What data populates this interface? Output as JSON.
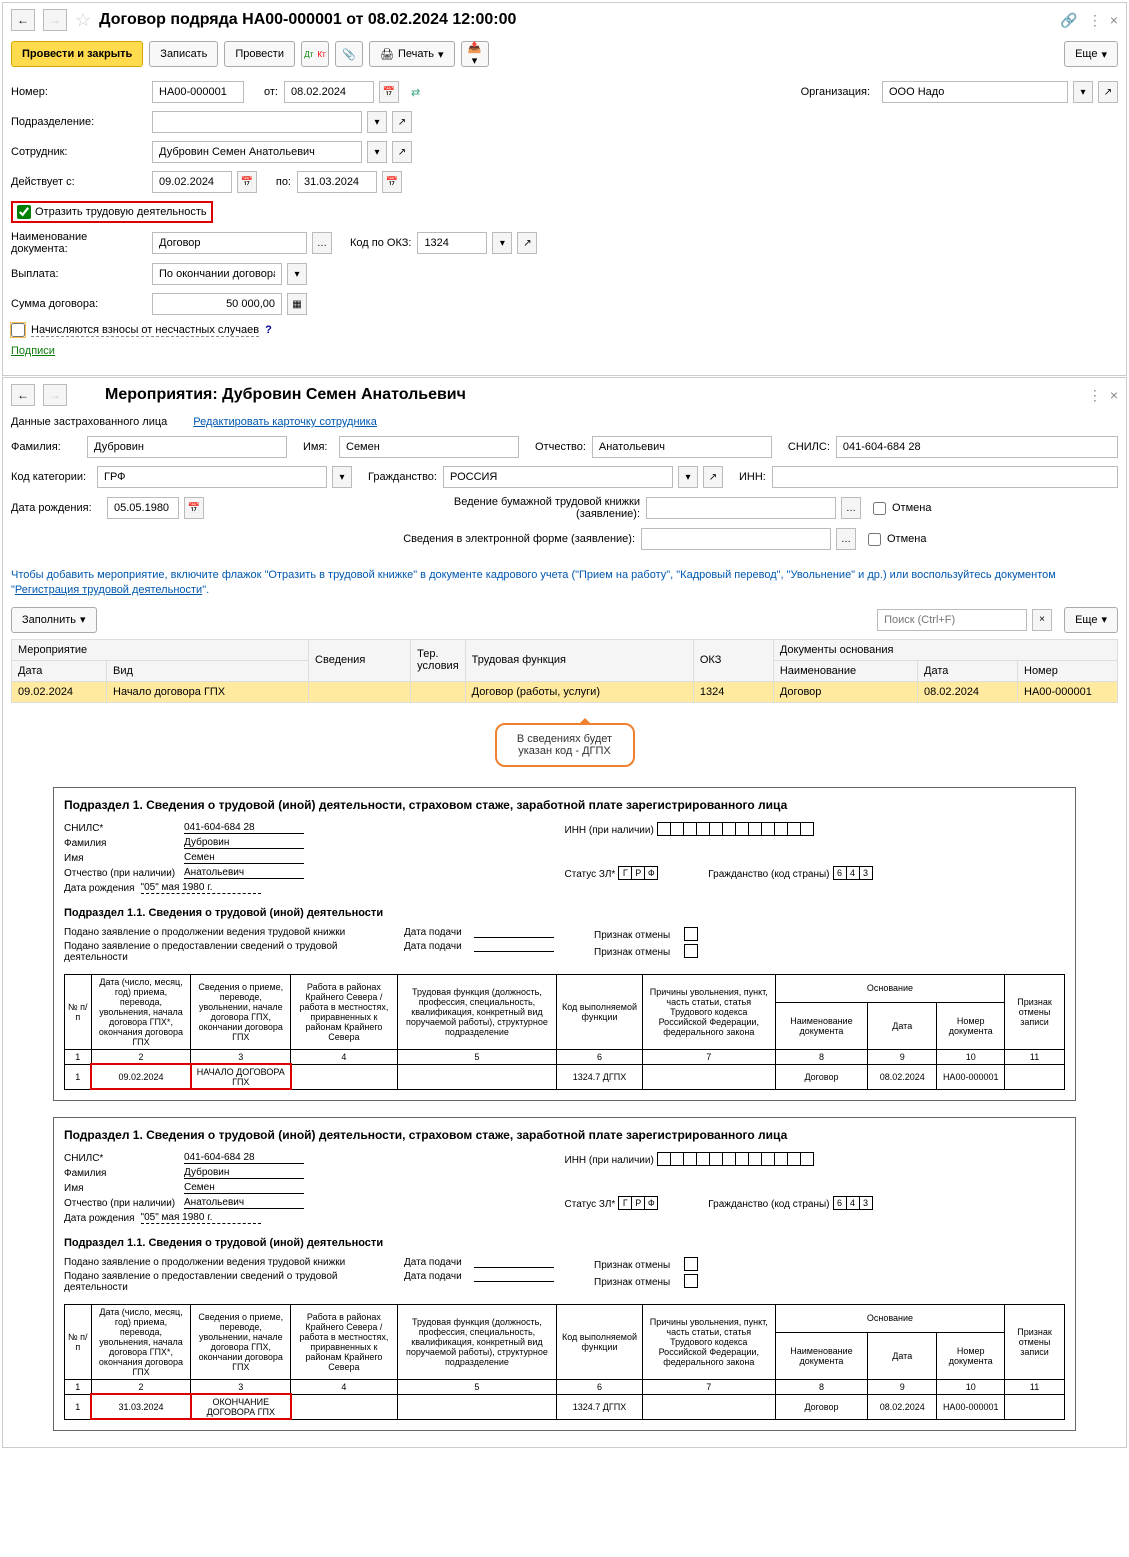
{
  "win1": {
    "title": "Договор подряда НА00-000001 от 08.02.2024 12:00:00",
    "toolbar": {
      "post_close": "Провести и закрыть",
      "write": "Записать",
      "post": "Провести",
      "print": "Печать",
      "more": "Еще"
    },
    "labels": {
      "number": "Номер:",
      "from": "от:",
      "org": "Организация:",
      "dept": "Подразделение:",
      "employee": "Сотрудник:",
      "valid_from": "Действует с:",
      "to": "по:",
      "reflect": "Отразить трудовую деятельность",
      "docname": "Наименование документа:",
      "okz": "Код по ОКЗ:",
      "payment": "Выплата:",
      "sum": "Сумма договора:",
      "accident": "Начисляются взносы от несчастных случаев",
      "signatures": "Подписи"
    },
    "values": {
      "number": "НА00-000001",
      "date": "08.02.2024",
      "org": "ООО Надо",
      "employee": "Дубровин Семен Анатольевич",
      "valid_from": "09.02.2024",
      "valid_to": "31.03.2024",
      "docname": "Договор",
      "okz": "1324",
      "payment": "По окончании договора",
      "sum": "50 000,00"
    }
  },
  "win2": {
    "title": "Мероприятия: Дубровин Семен Анатольевич",
    "insured_label": "Данные застрахованного лица",
    "edit_link": "Редактировать карточку сотрудника",
    "labels": {
      "lastname": "Фамилия:",
      "firstname": "Имя:",
      "middlename": "Отчество:",
      "snils": "СНИЛС:",
      "cat": "Код категории:",
      "citizen": "Гражданство:",
      "inn": "ИНН:",
      "dob": "Дата рождения:",
      "paper_book": "Ведение бумажной трудовой книжки (заявление):",
      "electronic": "Сведения в электронной форме (заявление):",
      "cancel": "Отмена"
    },
    "values": {
      "lastname": "Дубровин",
      "firstname": "Семен",
      "middlename": "Анатольевич",
      "snils": "041-604-684 28",
      "cat": "ГРФ",
      "citizen": "РОССИЯ",
      "dob": "05.05.1980"
    },
    "info_text_1": "Чтобы добавить мероприятие, включите флажок \"Отразить в трудовой книжке\" в документе кадрового учета (\"Прием на работу\", \"Кадровый перевод\", \"Увольнение\" и др.) или воспользуйтесь документом \"",
    "info_link": "Регистрация трудовой деятельности",
    "info_text_2": "\".",
    "fill_btn": "Заполнить",
    "search_ph": "Поиск (Ctrl+F)",
    "more": "Еще",
    "table": {
      "h_event": "Мероприятие",
      "h_info": "Сведения",
      "h_terr": "Тер. условия",
      "h_func": "Трудовая функция",
      "h_okz": "ОКЗ",
      "h_basis": "Документы основания",
      "h_date": "Дата",
      "h_type": "Вид",
      "h_name": "Наименование",
      "h_num": "Номер",
      "row": {
        "date": "09.02.2024",
        "type": "Начало договора ГПХ",
        "func": "Договор (работы, услуги)",
        "okz": "1324",
        "doc_name": "Договор",
        "doc_date": "08.02.2024",
        "doc_num": "НА00-000001"
      }
    },
    "callout": "В сведениях будет указан код - ДГПХ"
  },
  "report1": {
    "section": "Подраздел 1. Сведения о трудовой (иной) деятельности, страховом стаже, заработной плате зарегистрированного лица",
    "snils_l": "СНИЛС*",
    "snils_v": "041-604-684 28",
    "inn_l": "ИНН (при наличии)",
    "lastname_l": "Фамилия",
    "lastname_v": "Дубровин",
    "firstname_l": "Имя",
    "firstname_v": "Семен",
    "middlename_l": "Отчество (при наличии)",
    "middlename_v": "Анатольевич",
    "dob_l": "Дата рождения",
    "dob_v": "\"05\" мая 1980 г.",
    "status_l": "Статус ЗЛ*",
    "citizen_l": "Гражданство (код страны)",
    "sub11": "Подраздел 1.1. Сведения о трудовой (иной) деятельности",
    "app1": "Подано заявление о продолжении ведения трудовой книжки",
    "app2": "Подано заявление о предоставлении сведений о трудовой деятельности",
    "date_sub": "Дата подачи",
    "cancel_sign": "Признак отмены",
    "headers": {
      "c1": "№ п/п",
      "c2": "Дата (число, месяц, год) приема, перевода, увольнения, начала договора ГПХ*, окончания договора ГПХ",
      "c3": "Сведения о приеме, переводе, увольнении, начале договора ГПХ, окончании договора ГПХ",
      "c4": "Работа в районах Крайнего Севера / работа в местностях, приравненных к районам Крайнего Севера",
      "c5": "Трудовая функция (должность, профессия, специальность, квалификация, конкретный вид поручаемой работы), структурное подразделение",
      "c6": "Код выполняемой функции",
      "c7": "Причины увольнения, пункт, часть статьи, статья Трудового кодекса Российской Федерации, федерального закона",
      "c_basis": "Основание",
      "c8": "Наименование документа",
      "c9": "Дата",
      "c10": "Номер документа",
      "c11": "Признак отмены записи"
    },
    "row": {
      "n": "1",
      "date": "09.02.2024",
      "event": "НАЧАЛО ДОГОВОРА ГПХ",
      "func_code": "1324.7 ДГПХ",
      "doc_name": "Договор",
      "doc_date": "08.02.2024",
      "doc_num": "НА00-000001"
    }
  },
  "report2": {
    "row": {
      "n": "1",
      "date": "31.03.2024",
      "event": "ОКОНЧАНИЕ ДОГОВОРА ГПХ",
      "func_code": "1324.7 ДГПХ",
      "doc_name": "Договор",
      "doc_date": "08.02.2024",
      "doc_num": "НА00-000001"
    }
  },
  "status_boxes": {
    "g": "Г",
    "r": "Р",
    "f": "Ф",
    "c1": "6",
    "c2": "4",
    "c3": "3"
  }
}
